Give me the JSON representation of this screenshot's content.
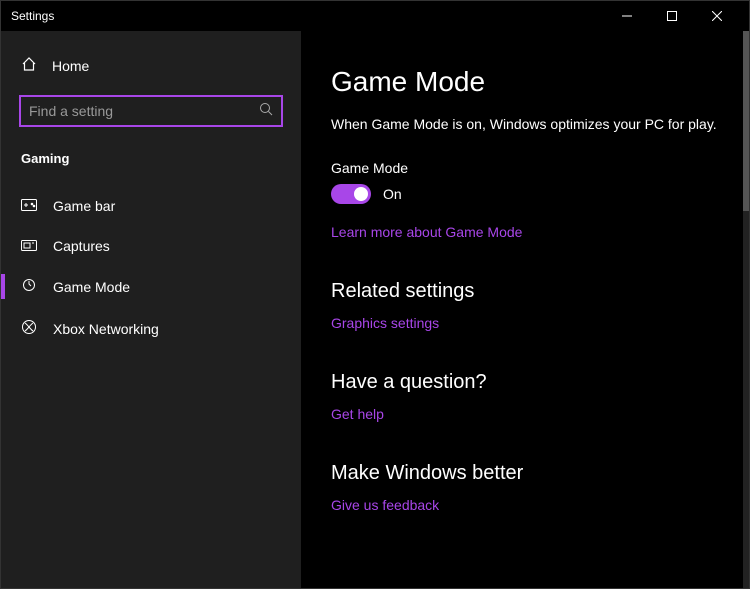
{
  "window": {
    "title": "Settings"
  },
  "sidebar": {
    "home": "Home",
    "search_placeholder": "Find a setting",
    "section": "Gaming",
    "items": [
      {
        "label": "Game bar"
      },
      {
        "label": "Captures"
      },
      {
        "label": "Game Mode"
      },
      {
        "label": "Xbox Networking"
      }
    ]
  },
  "main": {
    "title": "Game Mode",
    "description": "When Game Mode is on, Windows optimizes your PC for play.",
    "toggle": {
      "label": "Game Mode",
      "state": "On"
    },
    "learn_more": "Learn more about Game Mode",
    "related": {
      "heading": "Related settings",
      "link": "Graphics settings"
    },
    "question": {
      "heading": "Have a question?",
      "link": "Get help"
    },
    "better": {
      "heading": "Make Windows better",
      "link": "Give us feedback"
    }
  }
}
